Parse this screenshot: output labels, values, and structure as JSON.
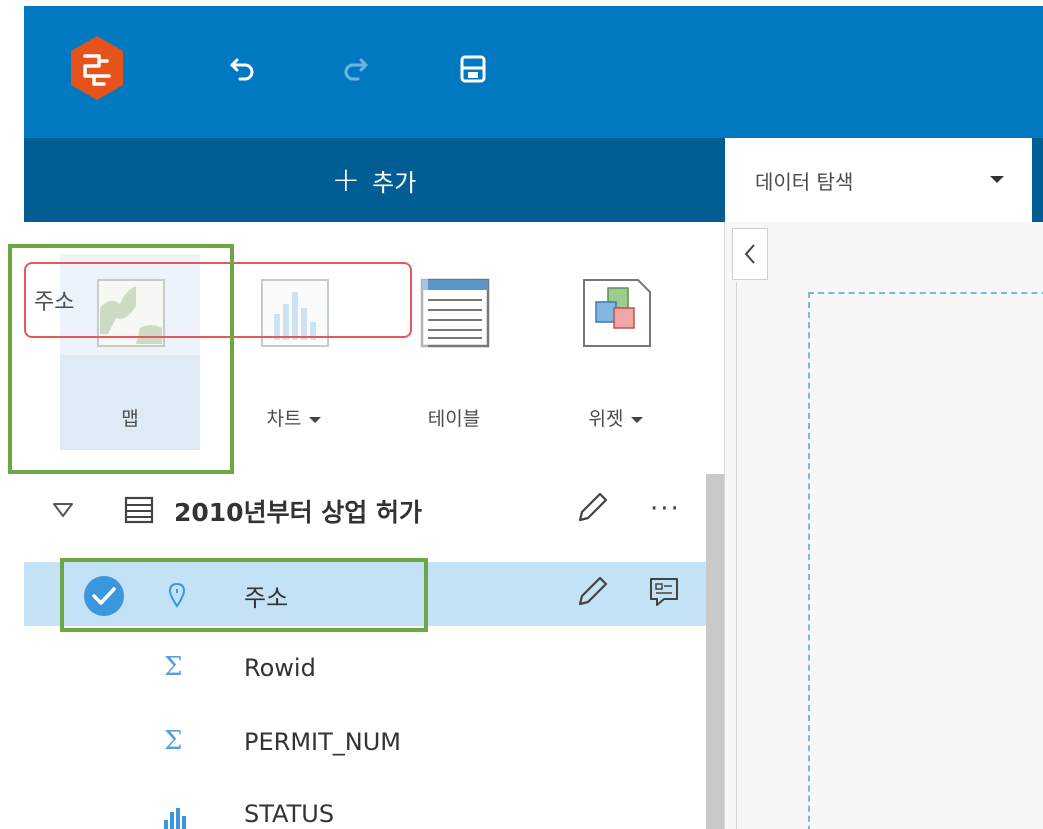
{
  "header": {
    "logo_icon": "insights-logo-icon",
    "undo_icon": "undo-icon",
    "redo_icon": "redo-icon",
    "save_icon": "save-icon",
    "brand_color": "#0079c1",
    "logo_color": "#e5531a"
  },
  "add_bar": {
    "label": "추가",
    "plus_icon": "plus-icon"
  },
  "page_tab": {
    "label": "데이터 탐색",
    "dropdown_icon": "caret-down-icon"
  },
  "search": {
    "value": "주소"
  },
  "viz_types": [
    {
      "label": "맵",
      "icon": "map-icon",
      "selected": true
    },
    {
      "label": "차트",
      "icon": "chart-icon",
      "has_dropdown": true
    },
    {
      "label": "테이블",
      "icon": "table-icon"
    },
    {
      "label": "위젯",
      "icon": "widget-icon",
      "has_dropdown": true
    }
  ],
  "dataset": {
    "title": "2010년부터 상업 허가",
    "expand_icon": "triangle-down-icon",
    "table_icon": "table-list-icon",
    "edit_icon": "pencil-icon",
    "more_icon": "more-icon"
  },
  "fields": [
    {
      "name": "주소",
      "type": "location",
      "selected": true
    },
    {
      "name": "Rowid",
      "type": "number"
    },
    {
      "name": "PERMIT_NUM",
      "type": "number"
    },
    {
      "name": "STATUS",
      "type": "string"
    }
  ],
  "colors": {
    "selection": "#c3e2f5",
    "highlight_green": "#6ca744",
    "search_border": "#e8575b",
    "check_blue": "#3a96dd"
  }
}
